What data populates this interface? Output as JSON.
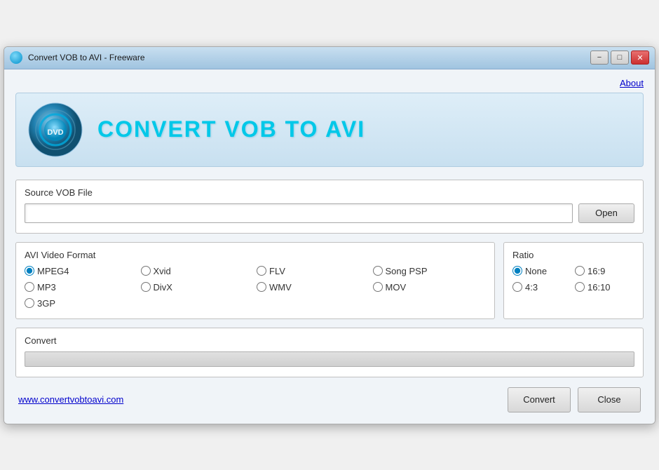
{
  "window": {
    "title": "Convert VOB to AVI - Freeware",
    "min_label": "−",
    "max_label": "□",
    "close_label": "✕"
  },
  "header": {
    "app_title": "CONVERT VOB TO AVI",
    "about_label": "About"
  },
  "source_vob": {
    "label": "Source VOB File",
    "input_value": "",
    "input_placeholder": "",
    "open_label": "Open"
  },
  "avi_format": {
    "label": "AVI Video Format",
    "formats": [
      {
        "id": "mpeg4",
        "label": "MPEG4",
        "checked": true
      },
      {
        "id": "xvid",
        "label": "Xvid",
        "checked": false
      },
      {
        "id": "flv",
        "label": "FLV",
        "checked": false
      },
      {
        "id": "songpsp",
        "label": "Song PSP",
        "checked": false
      },
      {
        "id": "mp3",
        "label": "MP3",
        "checked": false
      },
      {
        "id": "divx",
        "label": "DivX",
        "checked": false
      },
      {
        "id": "wmv",
        "label": "WMV",
        "checked": false
      },
      {
        "id": "mov",
        "label": "MOV",
        "checked": false
      },
      {
        "id": "3gp",
        "label": "3GP",
        "checked": false
      }
    ]
  },
  "ratio": {
    "label": "Ratio",
    "options": [
      {
        "id": "none",
        "label": "None",
        "checked": true
      },
      {
        "id": "16x9",
        "label": "16:9",
        "checked": false
      },
      {
        "id": "4x3",
        "label": "4:3",
        "checked": false
      },
      {
        "id": "16x10",
        "label": "16:10",
        "checked": false
      }
    ]
  },
  "convert_section": {
    "label": "Convert",
    "progress": 0
  },
  "bottom": {
    "website": "www.convertvobtoavi.com",
    "convert_label": "Convert",
    "close_label": "Close"
  }
}
